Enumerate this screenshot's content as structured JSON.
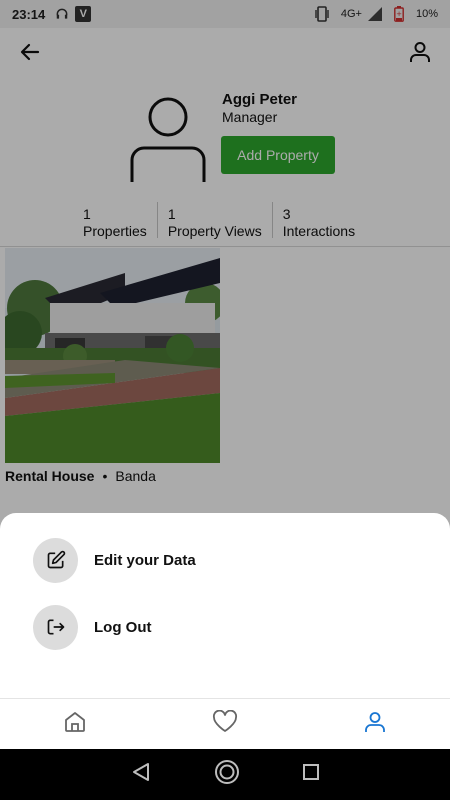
{
  "status_bar": {
    "time": "23:14",
    "network": "4G+",
    "battery": "10%",
    "icons": [
      "headphones-icon",
      "app-v-icon",
      "vibrate-icon",
      "signal-icon",
      "battery-icon"
    ],
    "v_badge": "V"
  },
  "app_bar": {
    "back_icon": "arrow-left-icon",
    "profile_icon": "user-icon"
  },
  "profile": {
    "name": "Aggi Peter",
    "role": "Manager",
    "add_button_label": "Add Property",
    "add_button_color": "#2ea82e"
  },
  "stats": [
    {
      "value": "1",
      "label": "Properties"
    },
    {
      "value": "1",
      "label": "Property Views"
    },
    {
      "value": "3",
      "label": "Interactions"
    }
  ],
  "listing": {
    "title": "Rental House",
    "separator": "•",
    "location": "Banda"
  },
  "bottom_sheet": {
    "items": [
      {
        "label": "Edit your Data",
        "icon": "edit-icon"
      },
      {
        "label": "Log Out",
        "icon": "logout-icon"
      }
    ]
  },
  "bottom_nav": {
    "items": [
      {
        "icon": "home-icon",
        "active": false
      },
      {
        "icon": "heart-icon",
        "active": false
      },
      {
        "icon": "user-icon",
        "active": true
      }
    ],
    "active_color": "#1976d2"
  }
}
